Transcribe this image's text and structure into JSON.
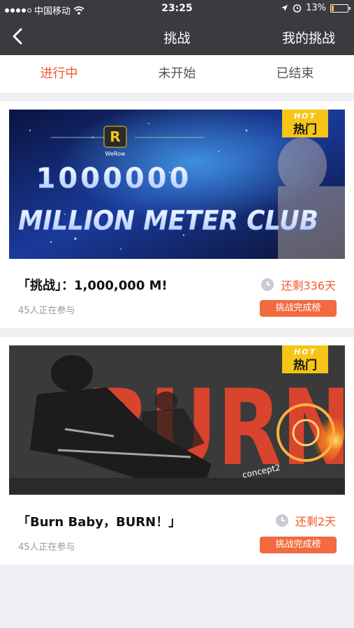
{
  "status_bar": {
    "carrier": "中国移动",
    "time": "23:25",
    "battery": "13%",
    "battery_level": 0.13
  },
  "nav": {
    "title": "挑战",
    "right_action": "我的挑战"
  },
  "tabs": [
    {
      "label": "进行中",
      "active": true
    },
    {
      "label": "未开始",
      "active": false
    },
    {
      "label": "已结束",
      "active": false
    }
  ],
  "challenges": [
    {
      "badge_en": "HOT",
      "badge_cn": "热门",
      "banner_brand": "WeRow",
      "banner_number": "1000000",
      "banner_text": "MILLION METER CLUB",
      "title": "「挑战」：1,000,000 M!",
      "remaining": "还剩336天",
      "participants": "45人正在参与",
      "button": "挑战完成榜"
    },
    {
      "badge_en": "HOT",
      "badge_cn": "热门",
      "banner_text": "BURN",
      "banner_brand": "concept2",
      "title": "「Burn Baby，BURN！」",
      "remaining": "还剩2天",
      "participants": "45人正在参与",
      "button": "挑战完成榜"
    }
  ],
  "colors": {
    "accent": "#f05a28",
    "nav_bg": "#3b3a3f",
    "hot_badge": "#f5c518",
    "page_bg": "#efeff4"
  }
}
